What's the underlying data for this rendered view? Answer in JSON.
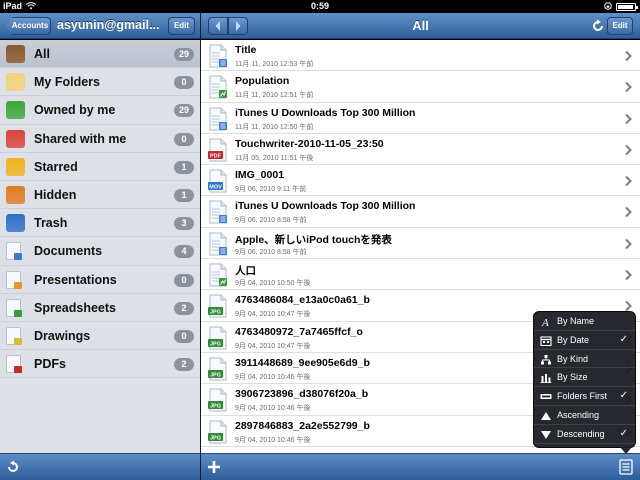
{
  "status_bar": {
    "carrier": "iPad",
    "time": "0:59"
  },
  "sidebar_nav": {
    "back_label": "Accounts",
    "title": "asyunin@gmail...",
    "edit_label": "Edit"
  },
  "main_nav": {
    "title": "All",
    "edit_label": "Edit"
  },
  "sidebar": {
    "items": [
      {
        "label": "All",
        "count": "29",
        "icon": "briefcase-icon",
        "color": "#8b5a2b",
        "selected": true
      },
      {
        "label": "My Folders",
        "count": "0",
        "icon": "folder-icon",
        "color": "#f2d37a"
      },
      {
        "label": "Owned by me",
        "count": "29",
        "icon": "person-icon",
        "color": "#3ca63a"
      },
      {
        "label": "Shared with me",
        "count": "0",
        "icon": "people-icon",
        "color": "#d9433b"
      },
      {
        "label": "Starred",
        "count": "1",
        "icon": "star-icon",
        "color": "#f0b21e"
      },
      {
        "label": "Hidden",
        "count": "1",
        "icon": "box-icon",
        "color": "#e07a24"
      },
      {
        "label": "Trash",
        "count": "3",
        "icon": "recycle-icon",
        "color": "#2f6fc4"
      },
      {
        "label": "Documents",
        "count": "4",
        "icon": "document-icon",
        "color": "#3a7bd5"
      },
      {
        "label": "Presentations",
        "count": "0",
        "icon": "presentation-icon",
        "color": "#e8952b"
      },
      {
        "label": "Spreadsheets",
        "count": "2",
        "icon": "spreadsheet-icon",
        "color": "#3c9a3c"
      },
      {
        "label": "Drawings",
        "count": "0",
        "icon": "drawing-icon",
        "color": "#d4b93a"
      },
      {
        "label": "PDFs",
        "count": "2",
        "icon": "pdf-icon",
        "color": "#c42a2a"
      }
    ]
  },
  "files": [
    {
      "name": "Title",
      "date": "11月 11, 2010 12:53 午前",
      "type": "doc"
    },
    {
      "name": "Population",
      "date": "11月 11, 2010 12:51 午前",
      "type": "sheet"
    },
    {
      "name": "iTunes U Downloads Top 300 Million",
      "date": "11月 11, 2010 12:50 午前",
      "type": "doc"
    },
    {
      "name": "Touchwriter-2010-11-05_23:50",
      "date": "11月 05, 2010 11:51 午後",
      "type": "pdf"
    },
    {
      "name": "IMG_0001",
      "date": "9月 06, 2010 9:11 午前",
      "type": "mov"
    },
    {
      "name": "iTunes U Downloads Top 300 Million",
      "date": "9月 06, 2010 8:58 午前",
      "type": "doc"
    },
    {
      "name": "Apple、新しいiPod touchを発表",
      "date": "9月 06, 2010 8:58 午前",
      "type": "doc"
    },
    {
      "name": "人口",
      "date": "9月 04, 2010 10:50 午後",
      "type": "sheet"
    },
    {
      "name": "4763486084_e13a0c0a61_b",
      "date": "9月 04, 2010 10:47 午後",
      "type": "jpg"
    },
    {
      "name": "4763480972_7a7465ffcf_o",
      "date": "9月 04, 2010 10:47 午後",
      "type": "jpg"
    },
    {
      "name": "3911448689_9ee905e6d9_b",
      "date": "9月 04, 2010 10:46 午後",
      "type": "jpg"
    },
    {
      "name": "3906723896_d38076f20a_b",
      "date": "9月 04, 2010 10:46 午後",
      "type": "jpg"
    },
    {
      "name": "2897846883_2a2e552799_b",
      "date": "9月 04, 2010 10:46 午後",
      "type": "jpg"
    }
  ],
  "file_badges": {
    "pdf": "PDF",
    "mov": "MOV",
    "jpg": "JPG"
  },
  "sort_menu": {
    "items": [
      {
        "label": "By Name",
        "checked": false,
        "icon": "italic-a-icon"
      },
      {
        "label": "By Date",
        "checked": true,
        "icon": "calendar-icon"
      },
      {
        "label": "By Kind",
        "checked": false,
        "icon": "hierarchy-icon"
      },
      {
        "label": "By Size",
        "checked": false,
        "icon": "bar-chart-icon"
      },
      {
        "label": "Folders First",
        "checked": true,
        "icon": "folder-bar-icon"
      },
      {
        "label": "Ascending",
        "checked": false,
        "icon": "triangle-up-icon"
      },
      {
        "label": "Descending",
        "checked": true,
        "icon": "triangle-down-icon"
      }
    ],
    "check_glyph": "✓"
  },
  "colors": {
    "nav_top": "#5f90c6",
    "nav_bottom": "#2e5f9c",
    "sidebar_bg": "#dde0e6",
    "badge_bg": "#8c939d"
  }
}
